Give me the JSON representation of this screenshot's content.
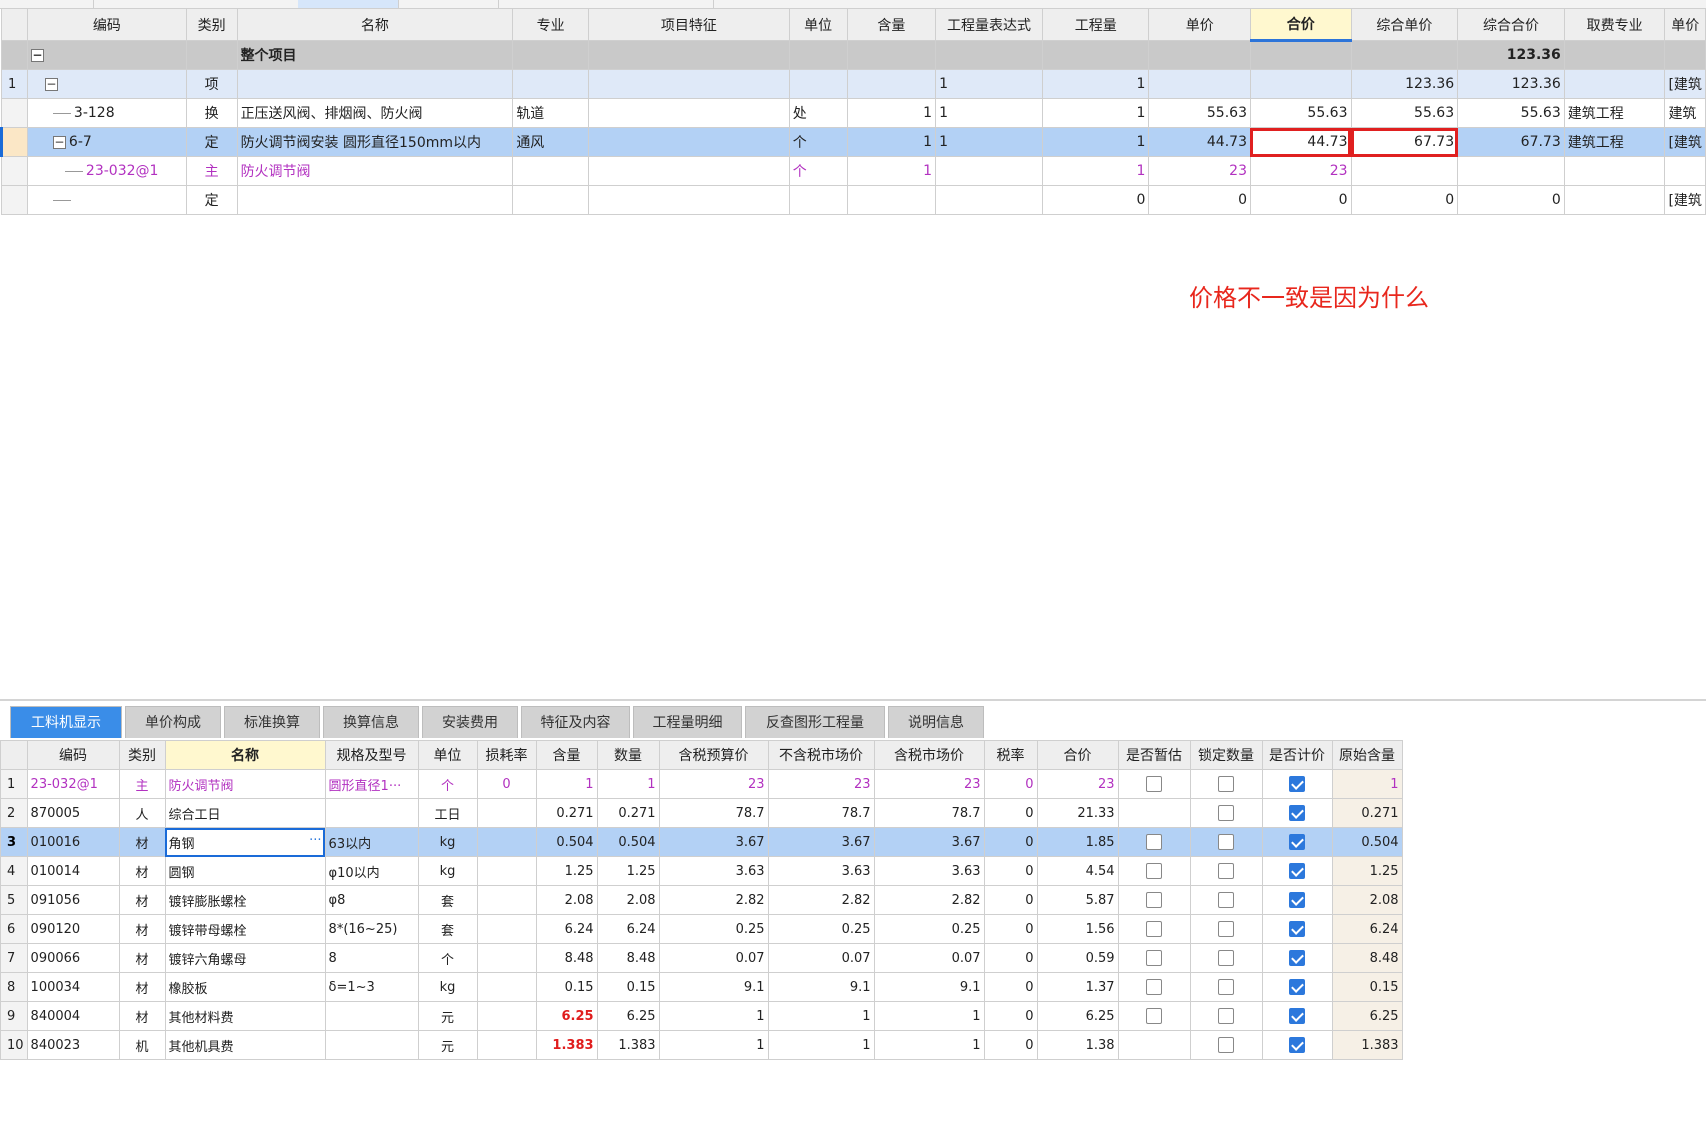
{
  "annotation": "价格不一致是因为什么",
  "upper": {
    "headers": [
      "编码",
      "类别",
      "名称",
      "专业",
      "项目特征",
      "单位",
      "含量",
      "工程量表达式",
      "工程量",
      "单价",
      "合价",
      "综合单价",
      "综合合价",
      "取费专业",
      "单价"
    ],
    "project_row": {
      "name": "整个项目",
      "total": "123.36"
    },
    "rows": [
      {
        "rn": "1",
        "code": "",
        "type": "项",
        "name": "",
        "spec": "",
        "feat": "",
        "unit": "",
        "qty": "",
        "expr": "1",
        "amount": "1",
        "price": "",
        "total": "",
        "cunit": "123.36",
        "ctotal": "123.36",
        "fee": "",
        "last": "[建筑"
      },
      {
        "rn": "",
        "code": "3-128",
        "type": "换",
        "name": "正压送风阀、排烟阀、防火阀",
        "spec": "轨道",
        "feat": "",
        "unit": "处",
        "qty": "1",
        "expr": "1",
        "amount": "1",
        "price": "55.63",
        "total": "55.63",
        "cunit": "55.63",
        "ctotal": "55.63",
        "fee": "建筑工程",
        "last": "建筑"
      },
      {
        "rn": "",
        "code": "6-7",
        "type": "定",
        "name": "防火调节阀安装 圆形直径150mm以内",
        "spec": "通风",
        "feat": "",
        "unit": "个",
        "qty": "1",
        "expr": "1",
        "amount": "1",
        "price": "44.73",
        "total": "44.73",
        "cunit": "67.73",
        "ctotal": "67.73",
        "fee": "建筑工程",
        "last": "[建筑"
      },
      {
        "rn": "",
        "code": "23-032@1",
        "type": "主",
        "name": "防火调节阀",
        "spec": "",
        "feat": "",
        "unit": "个",
        "qty": "1",
        "expr": "",
        "amount": "1",
        "price": "23",
        "total": "23",
        "cunit": "",
        "ctotal": "",
        "fee": "",
        "last": ""
      },
      {
        "rn": "",
        "code": "",
        "type": "定",
        "name": "",
        "spec": "",
        "feat": "",
        "unit": "",
        "qty": "",
        "expr": "",
        "amount": "0",
        "price": "0",
        "total": "0",
        "cunit": "0",
        "ctotal": "0",
        "fee": "",
        "last": "[建筑"
      }
    ]
  },
  "tabs": [
    "工料机显示",
    "单价构成",
    "标准换算",
    "换算信息",
    "安装费用",
    "特征及内容",
    "工程量明细",
    "反查图形工程量",
    "说明信息"
  ],
  "lower": {
    "headers": [
      "编码",
      "类别",
      "名称",
      "规格及型号",
      "单位",
      "损耗率",
      "含量",
      "数量",
      "含税预算价",
      "不含税市场价",
      "含税市场价",
      "税率",
      "合价",
      "是否暂估",
      "锁定数量",
      "是否计价",
      "原始含量"
    ],
    "rows": [
      {
        "rn": "1",
        "code": "23-032@1",
        "type": "主",
        "name": "防火调节阀",
        "spec": "圆形直径1···",
        "unit": "个",
        "loss": "0",
        "qty": "1",
        "num": "1",
        "tax_budget": "23",
        "market_notax": "23",
        "market_tax": "23",
        "rate": "0",
        "total": "23",
        "est": false,
        "lock": false,
        "priced": true,
        "orig": "1"
      },
      {
        "rn": "2",
        "code": "870005",
        "type": "人",
        "name": "综合工日",
        "spec": "",
        "unit": "工日",
        "loss": "",
        "qty": "0.271",
        "num": "0.271",
        "tax_budget": "78.7",
        "market_notax": "78.7",
        "market_tax": "78.7",
        "rate": "0",
        "total": "21.33",
        "est": null,
        "lock": false,
        "priced": true,
        "orig": "0.271"
      },
      {
        "rn": "3",
        "code": "010016",
        "type": "材",
        "name": "角钢",
        "spec": "63以内",
        "unit": "kg",
        "loss": "",
        "qty": "0.504",
        "num": "0.504",
        "tax_budget": "3.67",
        "market_notax": "3.67",
        "market_tax": "3.67",
        "rate": "0",
        "total": "1.85",
        "est": false,
        "lock": false,
        "priced": true,
        "orig": "0.504"
      },
      {
        "rn": "4",
        "code": "010014",
        "type": "材",
        "name": "圆钢",
        "spec": "φ10以内",
        "unit": "kg",
        "loss": "",
        "qty": "1.25",
        "num": "1.25",
        "tax_budget": "3.63",
        "market_notax": "3.63",
        "market_tax": "3.63",
        "rate": "0",
        "total": "4.54",
        "est": false,
        "lock": false,
        "priced": true,
        "orig": "1.25"
      },
      {
        "rn": "5",
        "code": "091056",
        "type": "材",
        "name": "镀锌膨胀螺栓",
        "spec": "φ8",
        "unit": "套",
        "loss": "",
        "qty": "2.08",
        "num": "2.08",
        "tax_budget": "2.82",
        "market_notax": "2.82",
        "market_tax": "2.82",
        "rate": "0",
        "total": "5.87",
        "est": false,
        "lock": false,
        "priced": true,
        "orig": "2.08"
      },
      {
        "rn": "6",
        "code": "090120",
        "type": "材",
        "name": "镀锌带母螺栓",
        "spec": "8*(16~25)",
        "unit": "套",
        "loss": "",
        "qty": "6.24",
        "num": "6.24",
        "tax_budget": "0.25",
        "market_notax": "0.25",
        "market_tax": "0.25",
        "rate": "0",
        "total": "1.56",
        "est": false,
        "lock": false,
        "priced": true,
        "orig": "6.24"
      },
      {
        "rn": "7",
        "code": "090066",
        "type": "材",
        "name": "镀锌六角螺母",
        "spec": "8",
        "unit": "个",
        "loss": "",
        "qty": "8.48",
        "num": "8.48",
        "tax_budget": "0.07",
        "market_notax": "0.07",
        "market_tax": "0.07",
        "rate": "0",
        "total": "0.59",
        "est": false,
        "lock": false,
        "priced": true,
        "orig": "8.48"
      },
      {
        "rn": "8",
        "code": "100034",
        "type": "材",
        "name": "橡胶板",
        "spec": "δ=1~3",
        "unit": "kg",
        "loss": "",
        "qty": "0.15",
        "num": "0.15",
        "tax_budget": "9.1",
        "market_notax": "9.1",
        "market_tax": "9.1",
        "rate": "0",
        "total": "1.37",
        "est": false,
        "lock": false,
        "priced": true,
        "orig": "0.15"
      },
      {
        "rn": "9",
        "code": "840004",
        "type": "材",
        "name": "其他材料费",
        "spec": "",
        "unit": "元",
        "loss": "",
        "qty": "6.25",
        "num": "6.25",
        "tax_budget": "1",
        "market_notax": "1",
        "market_tax": "1",
        "rate": "0",
        "total": "6.25",
        "est": false,
        "lock": false,
        "priced": true,
        "orig": "6.25"
      },
      {
        "rn": "10",
        "code": "840023",
        "type": "机",
        "name": "其他机具费",
        "spec": "",
        "unit": "元",
        "loss": "",
        "qty": "1.383",
        "num": "1.383",
        "tax_budget": "1",
        "market_notax": "1",
        "market_tax": "1",
        "rate": "0",
        "total": "1.38",
        "est": null,
        "lock": false,
        "priced": true,
        "orig": "1.383"
      }
    ]
  }
}
